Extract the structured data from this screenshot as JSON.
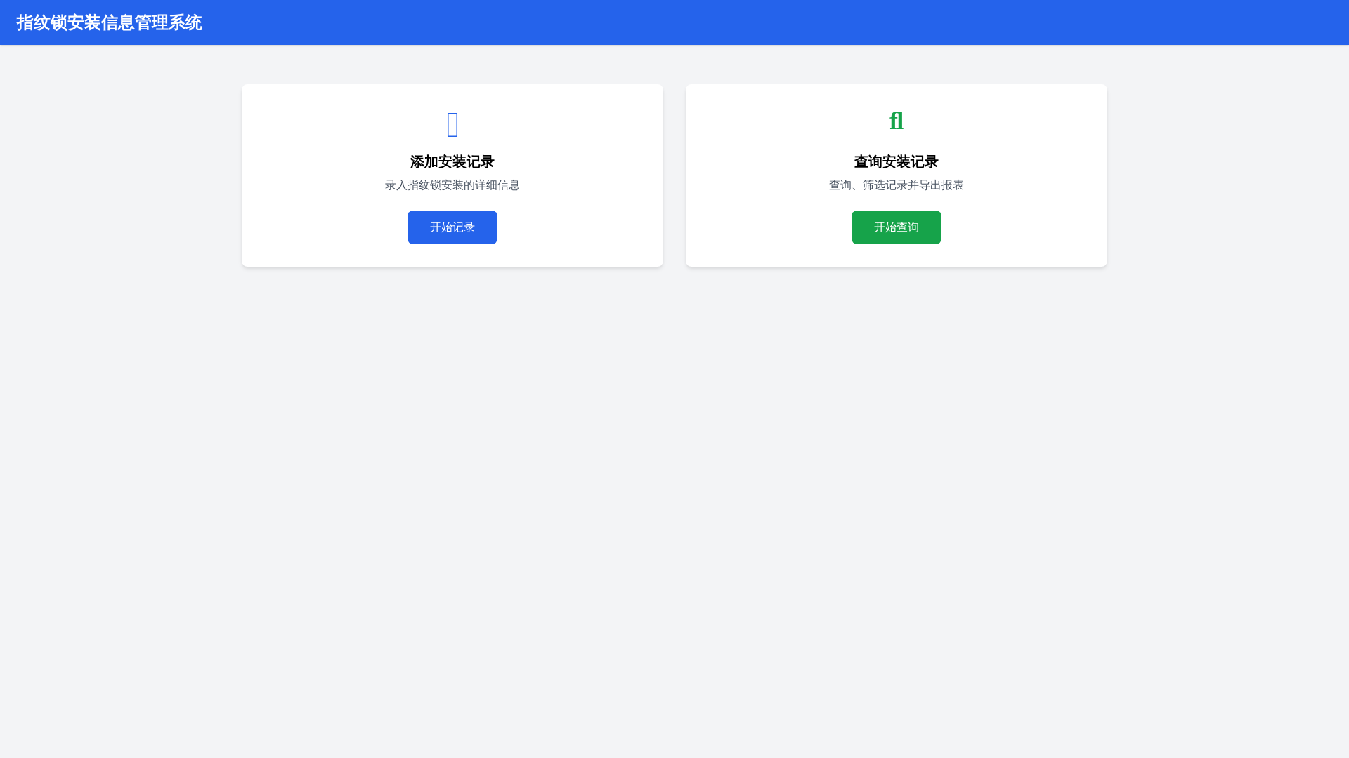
{
  "header": {
    "title": "指纹锁安装信息管理系统"
  },
  "cards": [
    {
      "color": "#2563eb",
      "title": "添加安装记录",
      "description": "录入指纹锁安装的详细信息",
      "button": "开始记录"
    },
    {
      "color": "#16a34a",
      "icon_glyph": "ﬂ",
      "title": "查询安装记录",
      "description": "查询、筛选记录并导出报表",
      "button": "开始查询"
    }
  ]
}
